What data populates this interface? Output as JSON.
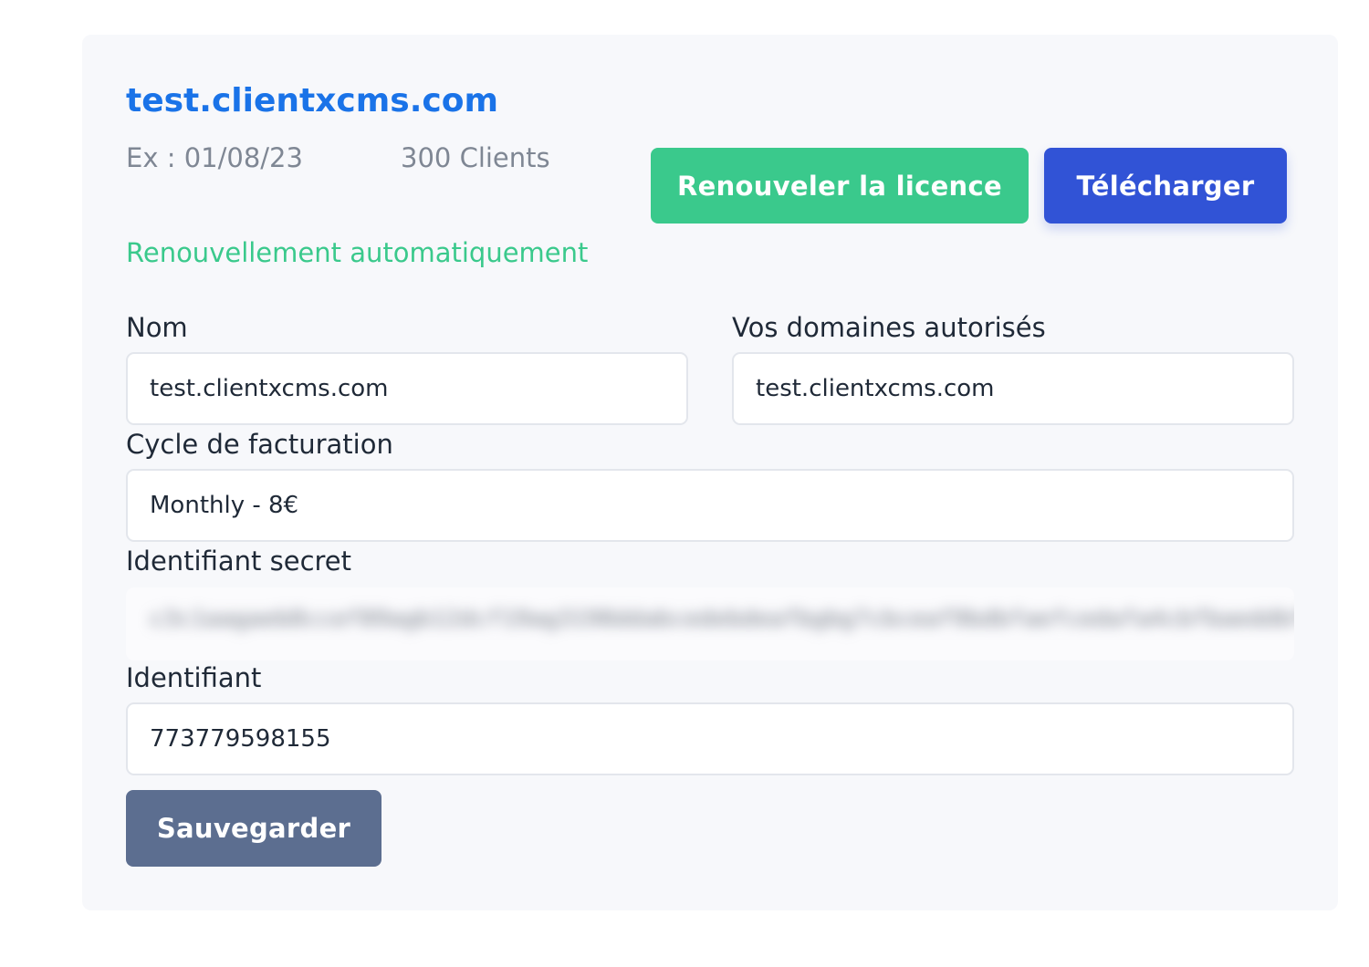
{
  "license": {
    "title": "test.clientxcms.com",
    "expiry": "Ex : 01/08/23",
    "clients": "300 Clients",
    "auto_renew": "Renouvellement automatiquement"
  },
  "actions": {
    "renew_label": "Renouveler la licence",
    "download_label": "Télécharger",
    "save_label": "Sauvegarder"
  },
  "form": {
    "name": {
      "label": "Nom",
      "value": "test.clientxcms.com"
    },
    "domains": {
      "label": "Vos domaines autorisés",
      "value": "test.clientxcms.com"
    },
    "billing_cycle": {
      "label": "Cycle de facturation",
      "value": "Monthly - 8€"
    },
    "secret": {
      "label": "Identifiant secret"
    },
    "identifier": {
      "label": "Identifiant",
      "value": "773779598155"
    }
  },
  "colors": {
    "accent_blue": "#1a73e8",
    "renew_green": "#3ac98c",
    "download_blue": "#3153d6",
    "save_slate": "#5c6e90"
  }
}
